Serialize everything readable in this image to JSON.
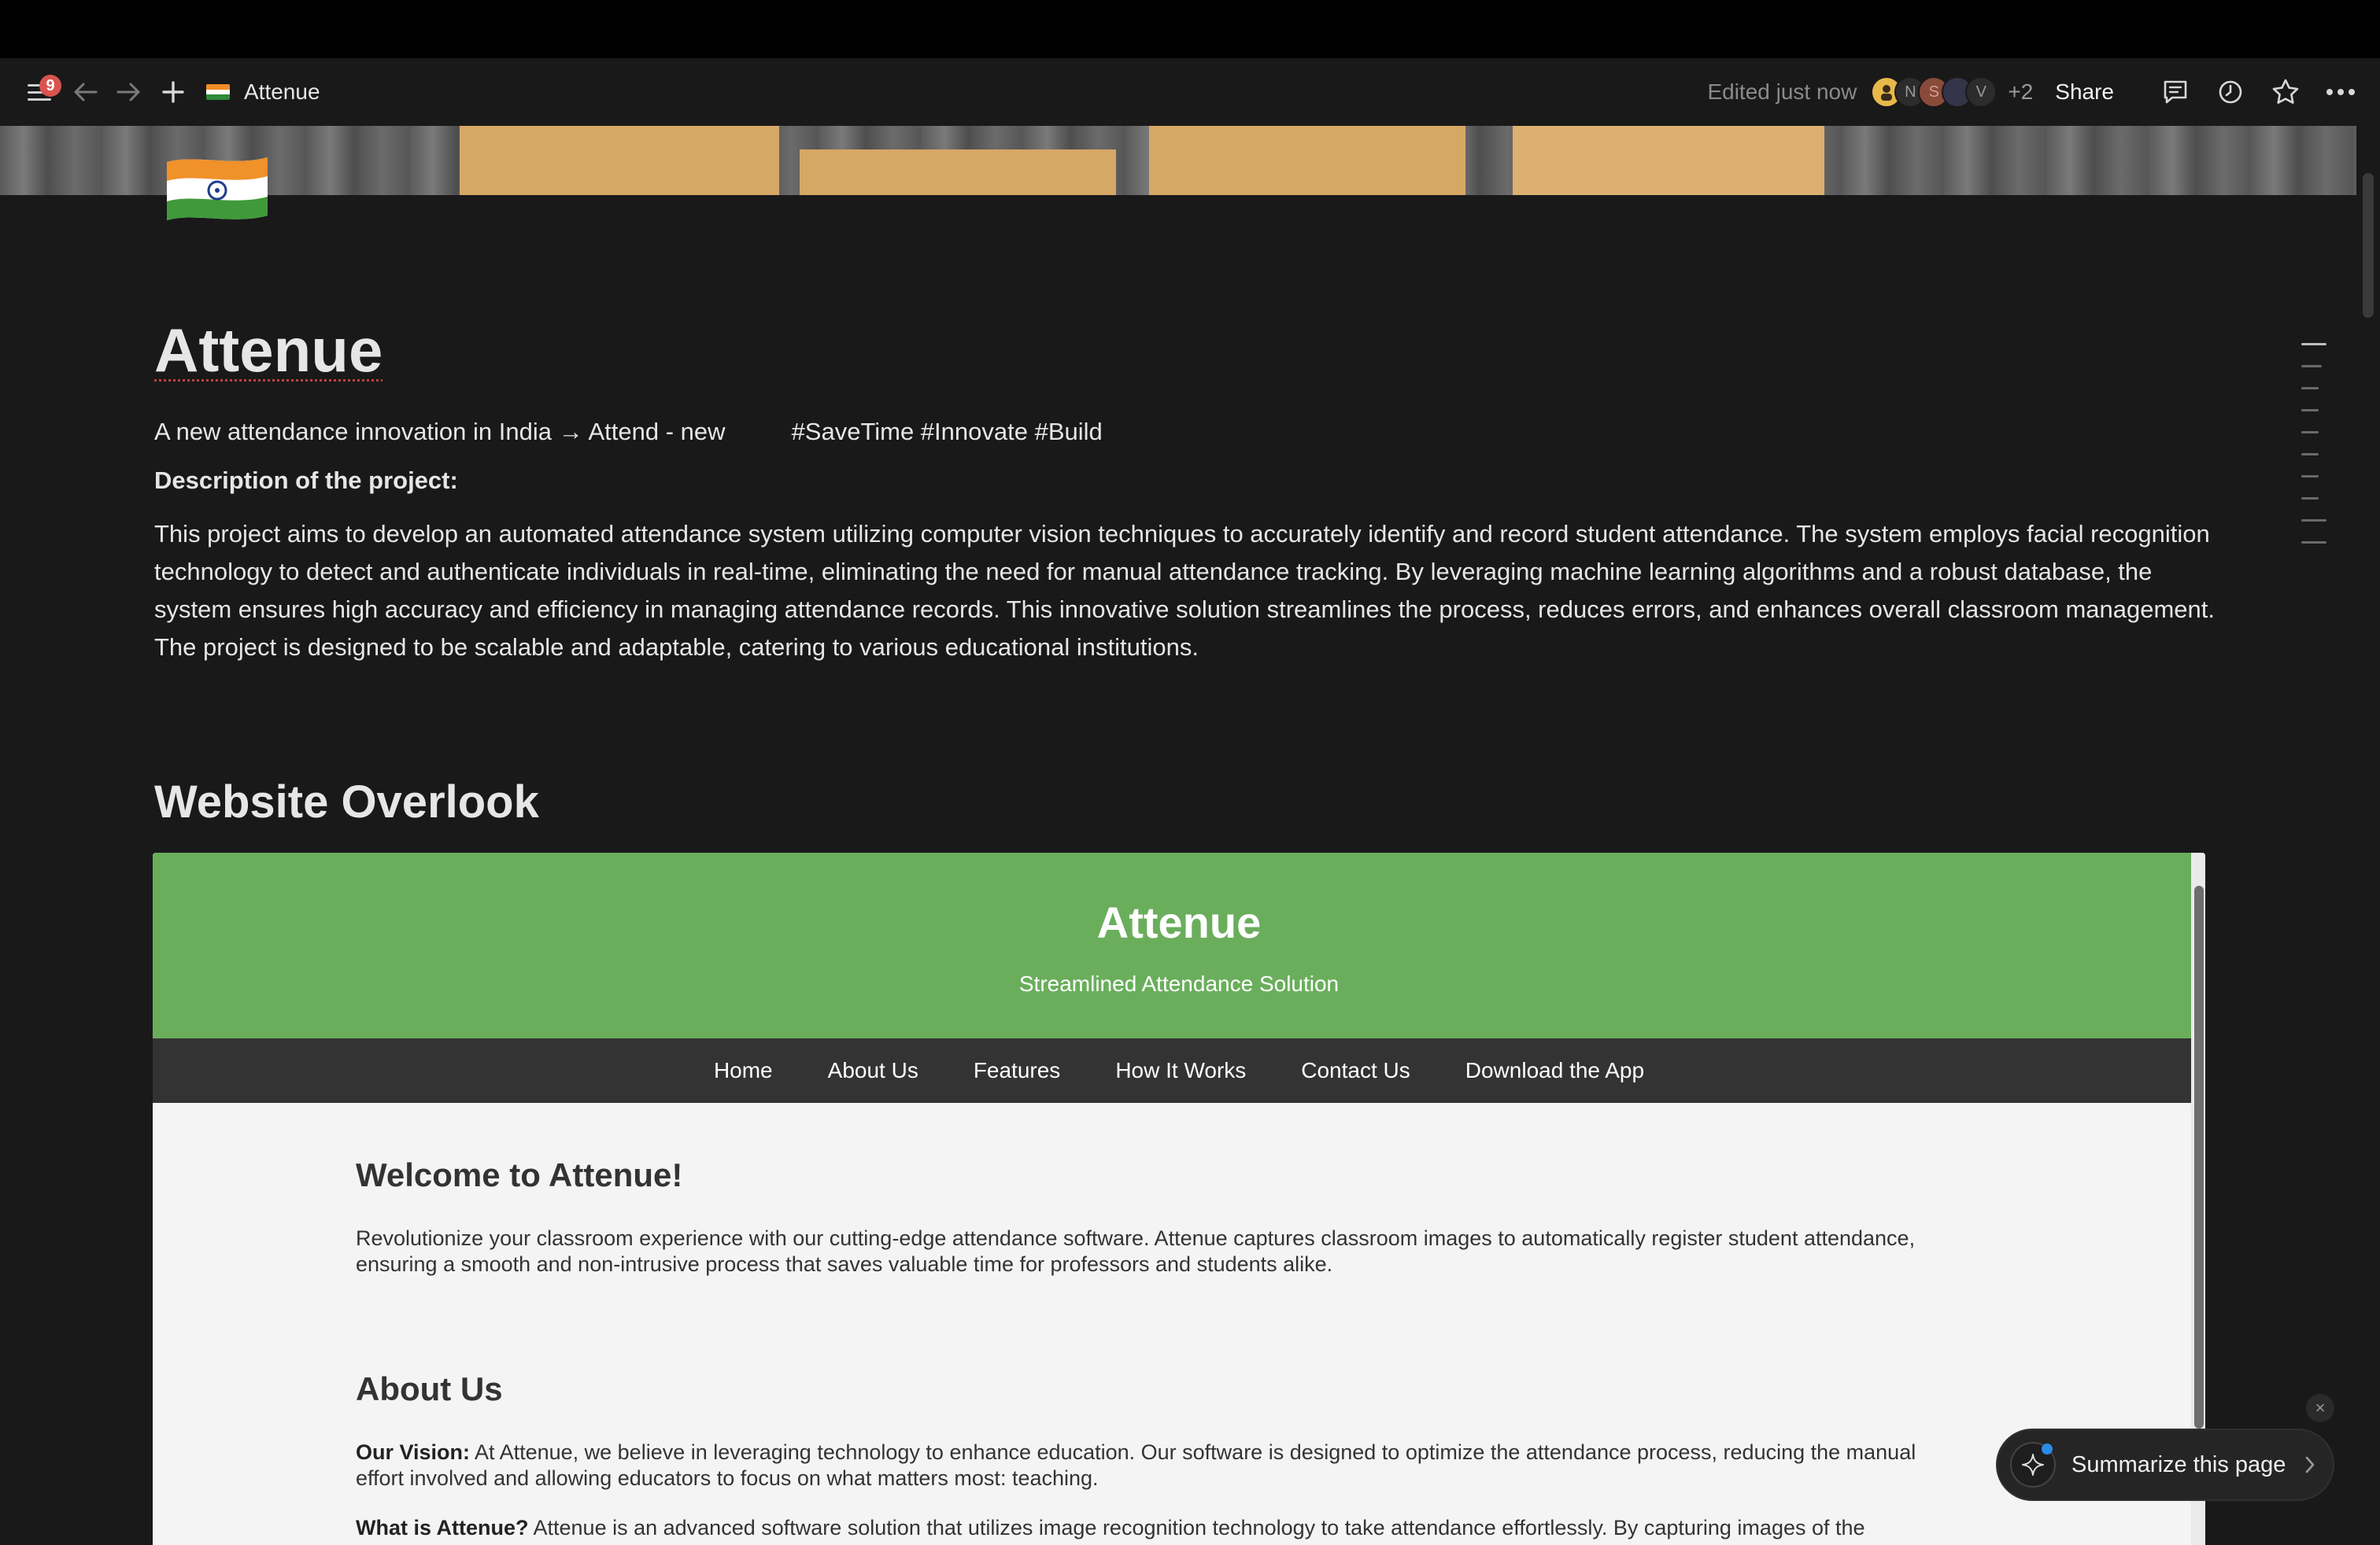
{
  "toolbar": {
    "notification_count": "9",
    "page_title": "Attenue",
    "edited_status": "Edited just now",
    "avatars": [
      "N",
      "S",
      "V"
    ],
    "extra_collaborators": "+2",
    "share_label": "Share",
    "icons": [
      "menu-icon",
      "back-arrow-icon",
      "forward-arrow-icon",
      "plus-icon",
      "comment-icon",
      "history-icon",
      "star-icon",
      "more-icon"
    ]
  },
  "page": {
    "title": "Attenue",
    "subtitle": "A new attendance innovation in India → Attend - new",
    "tags": "#SaveTime #Innovate #Build",
    "description_heading": "Description of the project:",
    "description": "This project aims to develop an automated attendance system utilizing computer vision techniques to accurately identify and record student attendance. The system employs facial recognition technology to detect and authenticate individuals in real-time, eliminating the need for manual attendance tracking. By leveraging machine learning algorithms and a robust database, the system ensures high accuracy and efficiency in managing attendance records. This innovative solution streamlines the process, reduces errors, and enhances overall classroom management. The project is designed to be scalable and adaptable, catering to various educational institutions.",
    "section_heading": "Website Overlook"
  },
  "embed": {
    "title": "Attenue",
    "subtitle": "Streamlined Attendance Solution",
    "nav": [
      "Home",
      "About Us",
      "Features",
      "How It Works",
      "Contact Us",
      "Download the App"
    ],
    "welcome_heading": "Welcome to Attenue!",
    "welcome_text": "Revolutionize your classroom experience with our cutting-edge attendance software. Attenue captures classroom images to automatically register student attendance, ensuring a smooth and non-intrusive process that saves valuable time for professors and students alike.",
    "about_heading": "About Us",
    "vision_label": "Our Vision:",
    "vision_text": "At Attenue, we believe in leveraging technology to enhance education. Our software is designed to optimize the attendance process, reducing the manual effort involved and allowing educators to focus on what matters most: teaching.",
    "what_label": "What is Attenue?",
    "what_text": "Attenue is an advanced software solution that utilizes image recognition technology to take attendance effortlessly. By capturing images of the"
  },
  "summarize": {
    "label": "Summarize this page",
    "close_glyph": "×"
  },
  "colors": {
    "background": "#191919",
    "embed_header": "#6aae5c",
    "embed_nav": "#333333",
    "badge": "#d9534f"
  }
}
